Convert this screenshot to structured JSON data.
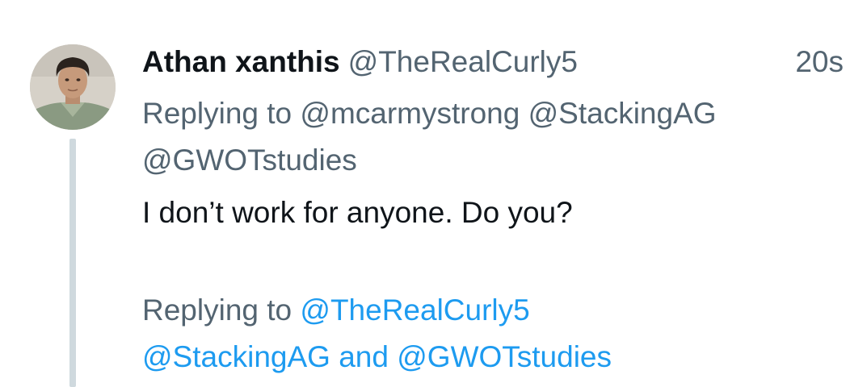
{
  "author": {
    "display_name": "Athan xanthis",
    "handle": "@TheRealCurly5"
  },
  "timestamp": "20s",
  "reply_context": {
    "prefix": "Replying to",
    "mentions": [
      "@mcarmystrong",
      "@StackingAG",
      "@GWOTstudies"
    ]
  },
  "text": "I don’t work for anyone. Do you?",
  "reply_context_2": {
    "prefix": "Replying to",
    "mentions": [
      "@TheRealCurly5",
      "@StackingAG",
      "@GWOTstudies"
    ],
    "conjunction": "and"
  },
  "colors": {
    "primary_text": "#0f1419",
    "secondary_text": "#536471",
    "link": "#1d9bf0",
    "thread_line": "#cfd9de"
  }
}
